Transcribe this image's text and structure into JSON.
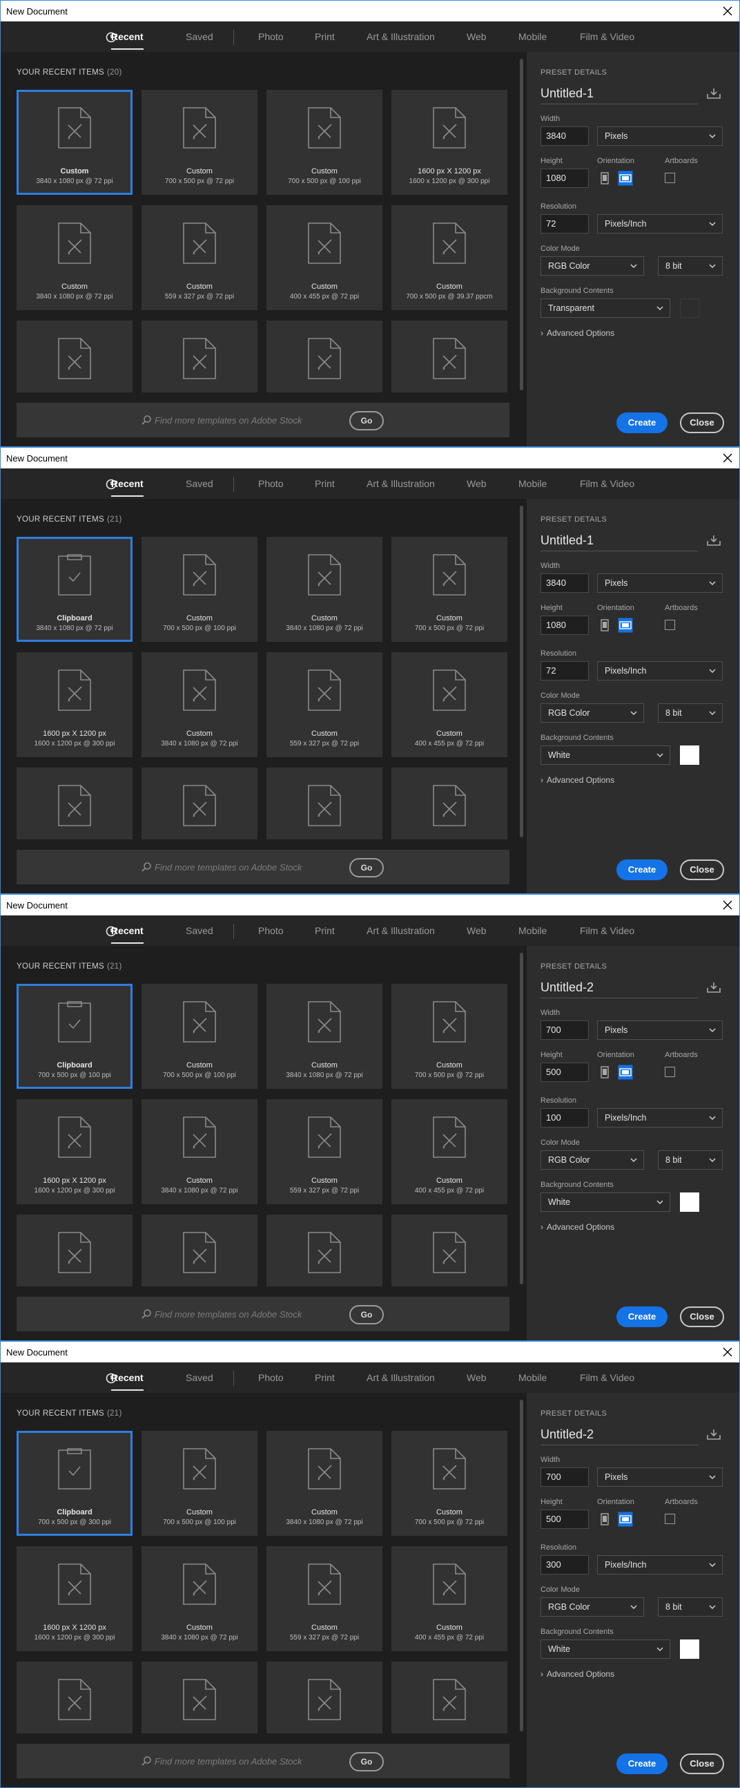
{
  "dialogs": [
    {
      "title": "New Document",
      "tabs": [
        "Recent",
        "Saved",
        "Photo",
        "Print",
        "Art & Illustration",
        "Web",
        "Mobile",
        "Film & Video"
      ],
      "active_tab": "Recent",
      "section_title": "YOUR RECENT ITEMS",
      "item_count": "(20)",
      "items": [
        {
          "name": "Custom",
          "desc": "3840 x 1080 px @ 72 ppi",
          "icon": "document-icon",
          "selected": true
        },
        {
          "name": "Custom",
          "desc": "700 x 500 px @ 72 ppi",
          "icon": "document-icon"
        },
        {
          "name": "Custom",
          "desc": "700 x 500 px @ 100 ppi",
          "icon": "document-icon"
        },
        {
          "name": "1600 px X 1200 px",
          "desc": "1600 x 1200 px @ 300 ppi",
          "icon": "document-icon"
        },
        {
          "name": "Custom",
          "desc": "3840 x 1080 px @ 72 ppi",
          "icon": "document-icon"
        },
        {
          "name": "Custom",
          "desc": "559 x 327 px @ 72 ppi",
          "icon": "document-icon"
        },
        {
          "name": "Custom",
          "desc": "400 x 455 px @ 72 ppi",
          "icon": "document-icon"
        },
        {
          "name": "Custom",
          "desc": "700 x 500 px @ 39.37 ppcm",
          "icon": "document-icon"
        }
      ],
      "search_placeholder": "Find more templates on Adobe Stock",
      "go_label": "Go",
      "preset_details_label": "PRESET DETAILS",
      "doc_name": "Untitled-1",
      "width_label": "Width",
      "width": "3840",
      "width_unit": "Pixels",
      "height_label": "Height",
      "height": "1080",
      "orientation_label": "Orientation",
      "artboards_label": "Artboards",
      "resolution_label": "Resolution",
      "resolution": "72",
      "resolution_unit": "Pixels/Inch",
      "color_mode_label": "Color Mode",
      "color_mode": "RGB Color",
      "bit_depth": "8 bit",
      "bg_label": "Background Contents",
      "bg": "Transparent",
      "bg_swatch": "#2d2d2d",
      "advanced_label": "Advanced Options",
      "create_label": "Create",
      "close_label": "Close"
    },
    {
      "title": "New Document",
      "tabs": [
        "Recent",
        "Saved",
        "Photo",
        "Print",
        "Art & Illustration",
        "Web",
        "Mobile",
        "Film & Video"
      ],
      "active_tab": "Recent",
      "section_title": "YOUR RECENT ITEMS",
      "item_count": "(21)",
      "items": [
        {
          "name": "Clipboard",
          "desc": "3840 x 1080 px @ 72 ppi",
          "icon": "clipboard-icon",
          "selected": true
        },
        {
          "name": "Custom",
          "desc": "700 x 500 px @ 100 ppi",
          "icon": "document-icon"
        },
        {
          "name": "Custom",
          "desc": "3840 x 1080 px @ 72 ppi",
          "icon": "document-icon"
        },
        {
          "name": "Custom",
          "desc": "700 x 500 px @ 72 ppi",
          "icon": "document-icon"
        },
        {
          "name": "1600 px X 1200 px",
          "desc": "1600 x 1200 px @ 300 ppi",
          "icon": "document-icon"
        },
        {
          "name": "Custom",
          "desc": "3840 x 1080 px @ 72 ppi",
          "icon": "document-icon"
        },
        {
          "name": "Custom",
          "desc": "559 x 327 px @ 72 ppi",
          "icon": "document-icon"
        },
        {
          "name": "Custom",
          "desc": "400 x 455 px @ 72 ppi",
          "icon": "document-icon"
        }
      ],
      "search_placeholder": "Find more templates on Adobe Stock",
      "go_label": "Go",
      "preset_details_label": "PRESET DETAILS",
      "doc_name": "Untitled-1",
      "width_label": "Width",
      "width": "3840",
      "width_unit": "Pixels",
      "height_label": "Height",
      "height": "1080",
      "orientation_label": "Orientation",
      "artboards_label": "Artboards",
      "resolution_label": "Resolution",
      "resolution": "72",
      "resolution_unit": "Pixels/Inch",
      "color_mode_label": "Color Mode",
      "color_mode": "RGB Color",
      "bit_depth": "8 bit",
      "bg_label": "Background Contents",
      "bg": "White",
      "bg_swatch": "#ffffff",
      "advanced_label": "Advanced Options",
      "create_label": "Create",
      "close_label": "Close"
    },
    {
      "title": "New Document",
      "tabs": [
        "Recent",
        "Saved",
        "Photo",
        "Print",
        "Art & Illustration",
        "Web",
        "Mobile",
        "Film & Video"
      ],
      "active_tab": "Recent",
      "section_title": "YOUR RECENT ITEMS",
      "item_count": "(21)",
      "items": [
        {
          "name": "Clipboard",
          "desc": "700 x 500 px @ 100 ppi",
          "icon": "clipboard-icon",
          "selected": true
        },
        {
          "name": "Custom",
          "desc": "700 x 500 px @ 100 ppi",
          "icon": "document-icon"
        },
        {
          "name": "Custom",
          "desc": "3840 x 1080 px @ 72 ppi",
          "icon": "document-icon"
        },
        {
          "name": "Custom",
          "desc": "700 x 500 px @ 72 ppi",
          "icon": "document-icon"
        },
        {
          "name": "1600 px X 1200 px",
          "desc": "1600 x 1200 px @ 300 ppi",
          "icon": "document-icon"
        },
        {
          "name": "Custom",
          "desc": "3840 x 1080 px @ 72 ppi",
          "icon": "document-icon"
        },
        {
          "name": "Custom",
          "desc": "559 x 327 px @ 72 ppi",
          "icon": "document-icon"
        },
        {
          "name": "Custom",
          "desc": "400 x 455 px @ 72 ppi",
          "icon": "document-icon"
        }
      ],
      "search_placeholder": "Find more templates on Adobe Stock",
      "go_label": "Go",
      "preset_details_label": "PRESET DETAILS",
      "doc_name": "Untitled-2",
      "width_label": "Width",
      "width": "700",
      "width_unit": "Pixels",
      "height_label": "Height",
      "height": "500",
      "orientation_label": "Orientation",
      "artboards_label": "Artboards",
      "resolution_label": "Resolution",
      "resolution": "100",
      "resolution_unit": "Pixels/Inch",
      "color_mode_label": "Color Mode",
      "color_mode": "RGB Color",
      "bit_depth": "8 bit",
      "bg_label": "Background Contents",
      "bg": "White",
      "bg_swatch": "#ffffff",
      "advanced_label": "Advanced Options",
      "create_label": "Create",
      "close_label": "Close"
    },
    {
      "title": "New Document",
      "tabs": [
        "Recent",
        "Saved",
        "Photo",
        "Print",
        "Art & Illustration",
        "Web",
        "Mobile",
        "Film & Video"
      ],
      "active_tab": "Recent",
      "section_title": "YOUR RECENT ITEMS",
      "item_count": "(21)",
      "items": [
        {
          "name": "Clipboard",
          "desc": "700 x 500 px @ 300 ppi",
          "icon": "clipboard-icon",
          "selected": true
        },
        {
          "name": "Custom",
          "desc": "700 x 500 px @ 100 ppi",
          "icon": "document-icon"
        },
        {
          "name": "Custom",
          "desc": "3840 x 1080 px @ 72 ppi",
          "icon": "document-icon"
        },
        {
          "name": "Custom",
          "desc": "700 x 500 px @ 72 ppi",
          "icon": "document-icon"
        },
        {
          "name": "1600 px X 1200 px",
          "desc": "1600 x 1200 px @ 300 ppi",
          "icon": "document-icon"
        },
        {
          "name": "Custom",
          "desc": "3840 x 1080 px @ 72 ppi",
          "icon": "document-icon"
        },
        {
          "name": "Custom",
          "desc": "559 x 327 px @ 72 ppi",
          "icon": "document-icon"
        },
        {
          "name": "Custom",
          "desc": "400 x 455 px @ 72 ppi",
          "icon": "document-icon"
        }
      ],
      "search_placeholder": "Find more templates on Adobe Stock",
      "go_label": "Go",
      "preset_details_label": "PRESET DETAILS",
      "doc_name": "Untitled-2",
      "width_label": "Width",
      "width": "700",
      "width_unit": "Pixels",
      "height_label": "Height",
      "height": "500",
      "orientation_label": "Orientation",
      "artboards_label": "Artboards",
      "resolution_label": "Resolution",
      "resolution": "300",
      "resolution_unit": "Pixels/Inch",
      "color_mode_label": "Color Mode",
      "color_mode": "RGB Color",
      "bit_depth": "8 bit",
      "bg_label": "Background Contents",
      "bg": "White",
      "bg_swatch": "#ffffff",
      "advanced_label": "Advanced Options",
      "create_label": "Create",
      "close_label": "Close"
    }
  ],
  "colors": {
    "accent": "#1473e6",
    "selection": "#2e7fe0",
    "panel": "#2d2d2d",
    "grid_bg": "#1e1e1e",
    "card": "#323232"
  }
}
